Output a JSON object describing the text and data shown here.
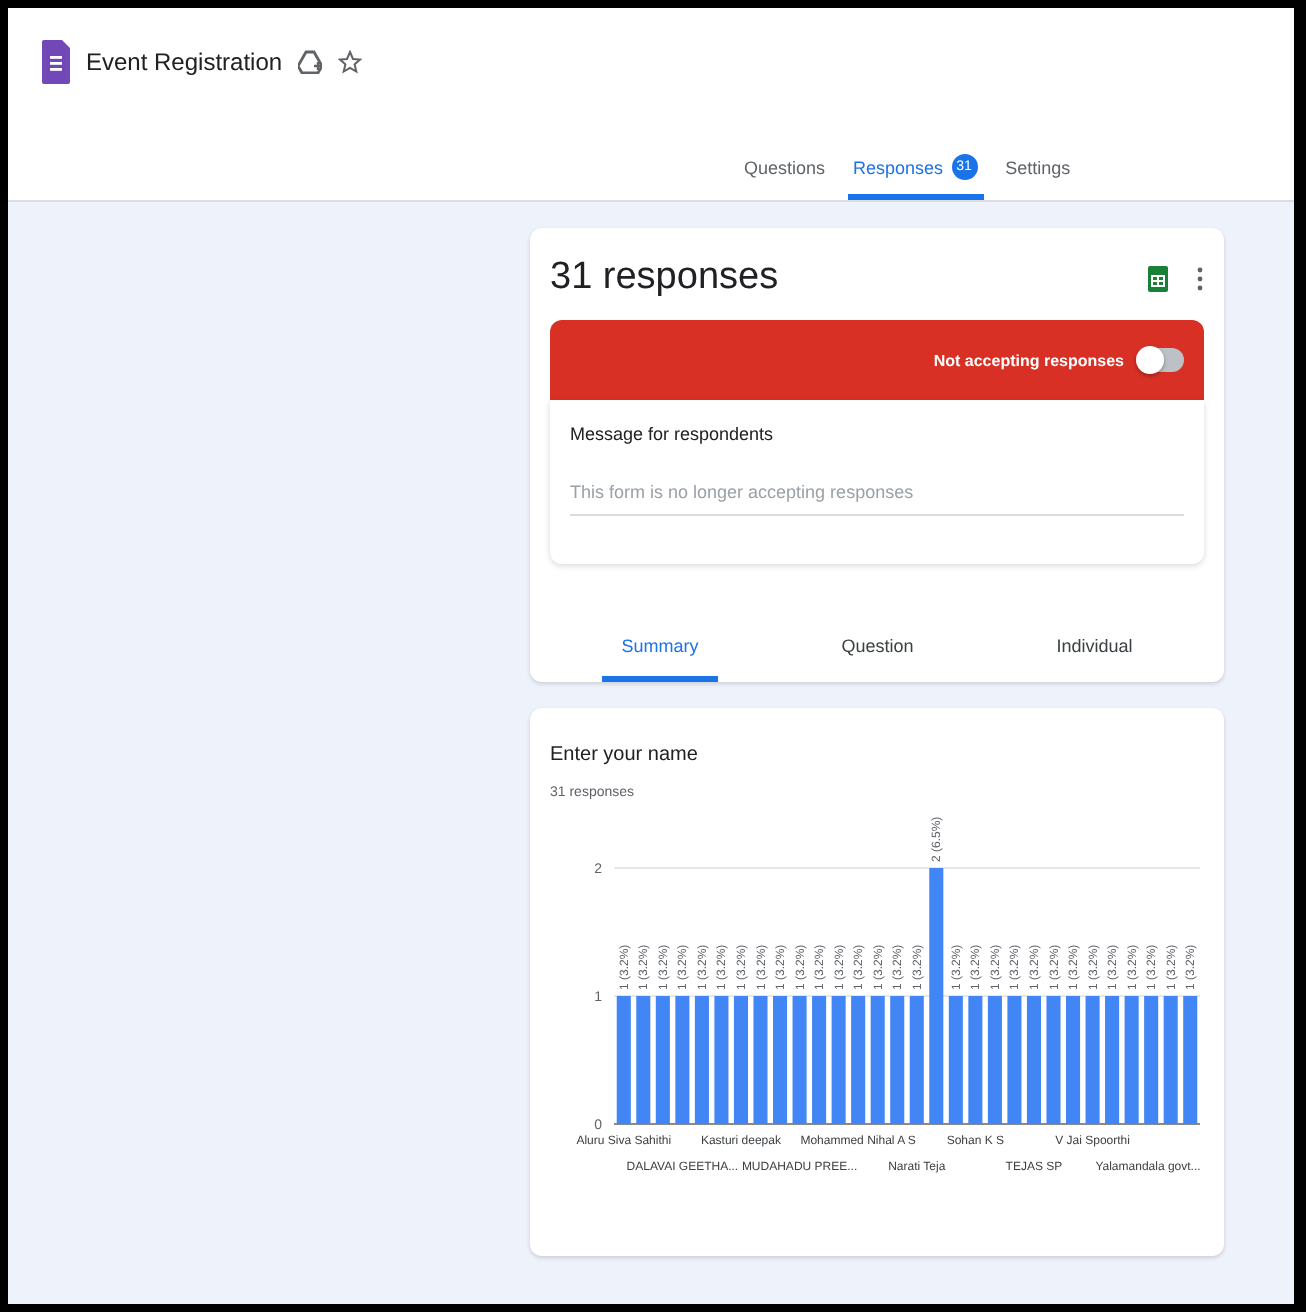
{
  "app": {
    "title": "Event Registration"
  },
  "tabs": [
    {
      "label": "Questions",
      "selected": false
    },
    {
      "label": "Responses",
      "selected": true,
      "badge": "31"
    },
    {
      "label": "Settings",
      "selected": false
    }
  ],
  "summary_card": {
    "title": "31 responses",
    "banner": {
      "label": "Not accepting responses",
      "on": false
    },
    "message": {
      "label": "Message for respondents",
      "value": "This form is no longer accepting responses"
    },
    "view_tabs": [
      {
        "label": "Summary",
        "selected": true
      },
      {
        "label": "Question",
        "selected": false
      },
      {
        "label": "Individual",
        "selected": false
      }
    ]
  },
  "question_card": {
    "title": "Enter your name",
    "subtitle": "31 responses",
    "chart_data": {
      "type": "bar",
      "ylim": [
        0,
        2
      ],
      "yticks": [
        0,
        1,
        2
      ],
      "categories": [
        "Aluru Siva Sahithi",
        null,
        null,
        "DALAVAI GEETHA...",
        null,
        null,
        "Kasturi deepak",
        null,
        null,
        "MUDAHADU PREE...",
        null,
        null,
        "Mohammed Nihal A S",
        null,
        null,
        "Narati Teja",
        null,
        null,
        "Sohan K S",
        null,
        null,
        "TEJAS SP",
        null,
        null,
        "V Jai Spoorthi",
        null,
        null,
        "Yalamandala govt...",
        null,
        null
      ],
      "values": [
        1,
        1,
        1,
        1,
        1,
        1,
        1,
        1,
        1,
        1,
        1,
        1,
        1,
        1,
        1,
        1,
        2,
        1,
        1,
        1,
        1,
        1,
        1,
        1,
        1,
        1,
        1,
        1,
        1,
        1
      ],
      "value_labels": [
        "1 (3.2%)",
        "1 (3.2%)",
        "1 (3.2%)",
        "1 (3.2%)",
        "1 (3.2%)",
        "1 (3.2%)",
        "1 (3.2%)",
        "1 (3.2%)",
        "1 (3.2%)",
        "1 (3.2%)",
        "1 (3.2%)",
        "1 (3.2%)",
        "1 (3.2%)",
        "1 (3.2%)",
        "1 (3.2%)",
        "1 (3.2%)",
        "2 (6.5%)",
        "1 (3.2%)",
        "1 (3.2%)",
        "1 (3.2%)",
        "1 (3.2%)",
        "1 (3.2%)",
        "1 (3.2%)",
        "1 (3.2%)",
        "1 (3.2%)",
        "1 (3.2%)",
        "1 (3.2%)",
        "1 (3.2%)",
        "1 (3.2%)",
        "1 (3.2%)"
      ]
    }
  }
}
